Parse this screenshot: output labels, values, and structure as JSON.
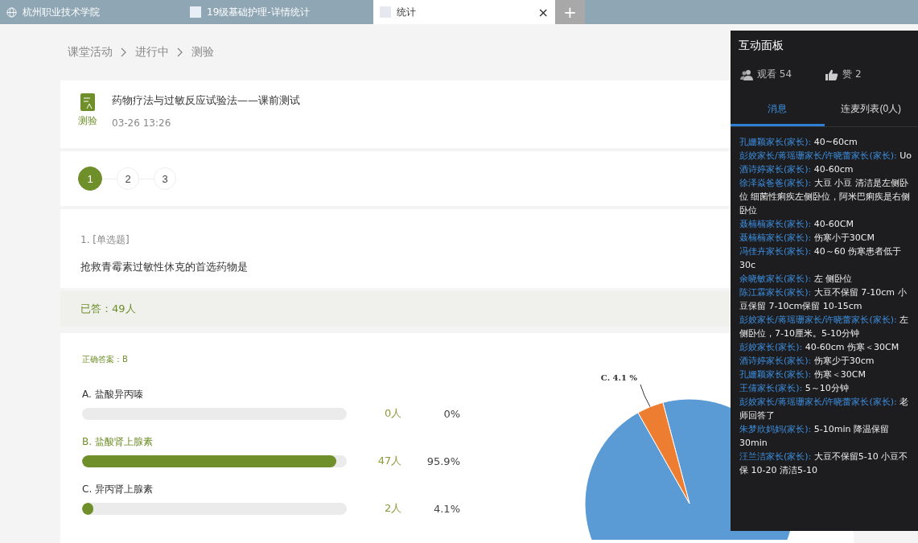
{
  "browser_tabs": [
    {
      "kind": "site",
      "label": "杭州职业技术学院",
      "selected": false
    },
    {
      "kind": "doc",
      "label": "19级基础护理-详情统计",
      "selected": false
    },
    {
      "kind": "doc",
      "label": "统计",
      "selected": true
    }
  ],
  "new_tab": "+",
  "close_tab": "×",
  "breadcrumb": [
    "课堂活动",
    "进行中",
    "测验"
  ],
  "activity": {
    "type_label": "测验",
    "title": "药物疗法与过敏反应试验法——课前测试",
    "time": "03-26 13:26"
  },
  "steps": [
    {
      "label": "1",
      "selected": true
    },
    {
      "label": "2",
      "selected": false
    },
    {
      "label": "3",
      "selected": false
    }
  ],
  "question": {
    "number": "1. [单选题]",
    "text": "抢救青霉素过敏性休克的首选药物是"
  },
  "answered": "已答：49人",
  "correct_answer": "正确答案：B",
  "options": [
    {
      "label": "A. 盐酸异丙嗪",
      "level": 0,
      "count": "0人",
      "percent": "0%",
      "correct": false
    },
    {
      "label": "B. 盐酸肾上腺素",
      "level": 0.959,
      "count": "47人",
      "percent": "95.9%",
      "correct": true
    },
    {
      "label": "C. 异丙肾上腺素",
      "level": 0.041,
      "count": "2人",
      "percent": "4.1%",
      "correct": false
    }
  ],
  "pie_label": "C. 4.1 %",
  "panel": {
    "title": "互动面板",
    "viewers": "观看 54",
    "likes": "赞 2",
    "tabs": [
      {
        "label": "消息",
        "selected": true
      },
      {
        "label": "连麦列表(0人)",
        "selected": false
      }
    ],
    "messages": [
      {
        "name": "孔姗颖家长(家长):",
        "text": "40~60cm"
      },
      {
        "name": "彭姣家长/蒋瑶珊家长/许晓蕾家长(家长):",
        "text": "Uo"
      },
      {
        "name": "酒诗婷家长(家长):",
        "text": "40-60cm"
      },
      {
        "name": "徐泽焱爸爸(家长):",
        "text": "大豆 小豆 清洁是左侧卧位 细菌性痢疾左侧卧位，阿米巴痢疾是右侧卧位"
      },
      {
        "name": "聂楠楠家长(家长):",
        "text": "40-60CM"
      },
      {
        "name": "聂楠楠家长(家长):",
        "text": "伤寒小于30CM"
      },
      {
        "name": "冯佳卉家长(家长):",
        "text": "40～60 伤寒患者低于30c"
      },
      {
        "name": "余晓敏家长(家长):",
        "text": "左 侧卧位"
      },
      {
        "name": "陈江霖家长(家长):",
        "text": "大豆不保留 7-10cm 小豆保留 7-10cm保留 10-15cm"
      },
      {
        "name": "彭姣家长/蒋瑶珊家长/许晓蕾家长(家长):",
        "text": "左侧卧位，7-10厘米。5-10分钟"
      },
      {
        "name": "彭姣家长(家长):",
        "text": "40-60cm 伤寒＜30CM"
      },
      {
        "name": "酒诗婷家长(家长):",
        "text": "伤寒少于30cm"
      },
      {
        "name": "孔姗颖家长(家长):",
        "text": "伤寒＜30CM"
      },
      {
        "name": "王倩家长(家长):",
        "text": "5～10分钟"
      },
      {
        "name": "彭姣家长/蒋瑶珊家长/许晓蕾家长(家长):",
        "text": "老师回答了"
      },
      {
        "name": "朱梦欣妈妈(家长):",
        "text": "5-10min 降温保留30min"
      },
      {
        "name": "汪兰洁家长(家长):",
        "text": "大豆不保留5-10 小豆不保 10-20 清洁5-10"
      }
    ]
  }
}
